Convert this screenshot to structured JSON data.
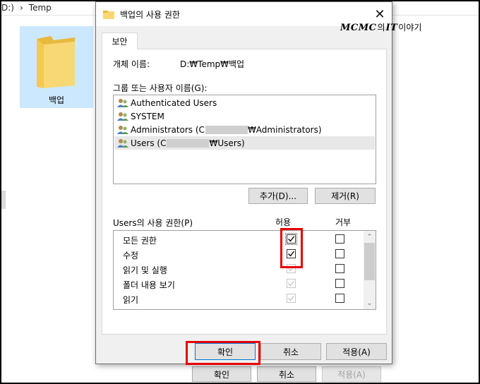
{
  "background": {
    "path_drive": "D:)",
    "path_sep": "›",
    "path_folder": "Temp",
    "folder_label": "백업",
    "buttons": [
      {
        "label": "확인",
        "enabled": true
      },
      {
        "label": "취소",
        "enabled": true
      },
      {
        "label": "적용(A)",
        "enabled": false
      }
    ]
  },
  "watermark": {
    "brand": "MCMC",
    "mid": "의",
    "tail_bold": "IT",
    "tail": " 이야기"
  },
  "dialog": {
    "title": "백업의 사용 권한",
    "close_glyph": "✕",
    "tab": "보안",
    "object_name_label": "개체 이름:",
    "object_name_value": "D:₩Temp₩백업",
    "group_label": "그룹 또는 사용자 이름(G):",
    "groups": [
      {
        "name": "Authenticated Users",
        "suffix": "",
        "selected": false,
        "redacted": false
      },
      {
        "name": "SYSTEM",
        "suffix": "",
        "selected": false,
        "redacted": false
      },
      {
        "name": "Administrators (C",
        "suffix": "₩Administrators)",
        "selected": false,
        "redacted": true
      },
      {
        "name": "Users (C",
        "suffix": "₩Users)",
        "selected": true,
        "redacted": true
      }
    ],
    "add_button": "추가(D)...",
    "remove_button": "제거(R)",
    "permissions_label": "Users의 사용 권한(P)",
    "allow_header": "허용",
    "deny_header": "거부",
    "permissions": [
      {
        "name": "모든 권한",
        "allow": true,
        "allow_enabled": true,
        "deny": false
      },
      {
        "name": "수정",
        "allow": true,
        "allow_enabled": true,
        "deny": false
      },
      {
        "name": "읽기 및 실행",
        "allow": true,
        "allow_enabled": false,
        "deny": false
      },
      {
        "name": "폴더 내용 보기",
        "allow": true,
        "allow_enabled": false,
        "deny": false
      },
      {
        "name": "읽기",
        "allow": true,
        "allow_enabled": false,
        "deny": false
      }
    ],
    "ok_button": "확인",
    "cancel_button": "취소",
    "apply_button": "적용(A)"
  },
  "colors": {
    "highlight_red": "#e60000",
    "folder_yellow": "#f8d775",
    "selection_blue": "#cce8ff"
  }
}
